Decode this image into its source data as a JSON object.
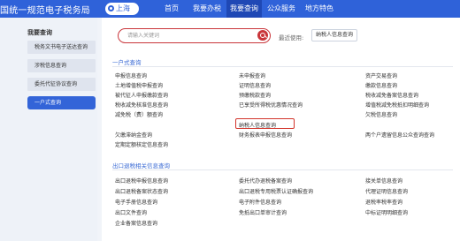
{
  "header": {
    "brand": "国统一规范电子税务局",
    "region": "上海",
    "nav": [
      "首页",
      "我要办税",
      "我要查询",
      "公众服务",
      "地方特色"
    ]
  },
  "sidebar": {
    "title": "我要查询",
    "items": [
      "税务文书电子送达查询",
      "涉税信息查询",
      "委托代征协议查询",
      "一户式查询"
    ]
  },
  "search": {
    "placeholder": "请输入关键词",
    "recent_label": "最近使用:",
    "recent_item": "纳税人信息查询"
  },
  "sections": [
    {
      "title": "一户式查询",
      "rows": [
        [
          "申报信息查询",
          "未申报查询",
          "资产交易查询"
        ],
        [
          "土地增值税申报查询",
          "证明信息查询",
          "缴款信息查询"
        ],
        [
          "被代征人申报缴款查询",
          "预缴税款查询",
          "税收减免备案信息查询"
        ],
        [
          "税收减免核准信息查询",
          "已享受所得税优惠情况查询",
          "增值税减免税抵扣明细查询"
        ],
        [
          "减免税（费）额查询",
          "纳税人信息查询",
          "欠税信息查询"
        ],
        [
          "欠缴滞纳金查询",
          "财务报表申报信息查询",
          "两个户遗留信息公众查询查询"
        ],
        [
          "定期定额核定信息查询",
          "",
          ""
        ]
      ]
    },
    {
      "title": "出口退税相关信息查询",
      "rows": [
        [
          "出口退税申报信息查询",
          "委托代办退税备案查询",
          "接关单信息查询"
        ],
        [
          "出口退税备案状态查询",
          "出口退税专用税票认证确报查询",
          "代理证明信息查询"
        ],
        [
          "电子手册信息查询",
          "电子附件信息查询",
          "退税率税率查询"
        ],
        [
          "出口文件查询",
          "免抵出口单审计查询",
          "中标证明明细查询"
        ],
        [
          "企业备案信息查询",
          "",
          ""
        ]
      ]
    }
  ],
  "colors": {
    "topbar": "#2f62d9",
    "accent": "#3364d8",
    "highlight": "#d2342b"
  }
}
